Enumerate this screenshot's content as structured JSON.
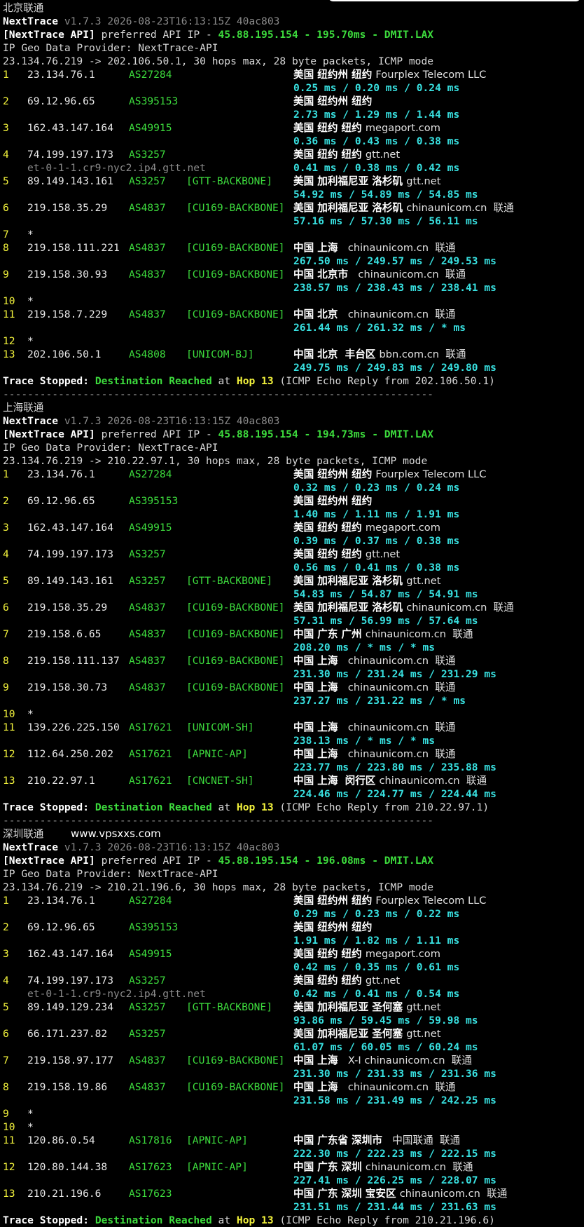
{
  "sections": [
    {
      "title": "北京联通",
      "version": "v1.7.3 2026-08-23T16:13:15Z 40ac803",
      "api_ip": "45.88.195.154",
      "api_ms": "195.70ms",
      "api_node": "DMIT.LAX",
      "geo_provider": "IP Geo Data Provider: NextTrace-API",
      "trace_info": "23.134.76.219 -> 202.106.50.1, 30 hops max, 28 byte packets, ICMP mode",
      "hops": [
        {
          "n": "1",
          "ip": "23.134.76.1",
          "asn": "AS27284",
          "bb": "",
          "geo": "美国 纽约州 纽约",
          "org": "Fourplex Telecom LLC",
          "time": "0.25 ms / 0.20 ms / 0.24 ms",
          "rdns": ""
        },
        {
          "n": "2",
          "ip": "69.12.96.65",
          "asn": "AS395153",
          "bb": "",
          "geo": "美国 纽约州 纽约",
          "org": "",
          "time": "2.73 ms / 1.29 ms / 1.44 ms",
          "rdns": ""
        },
        {
          "n": "3",
          "ip": "162.43.147.164",
          "asn": "AS49915",
          "bb": "",
          "geo": "美国 纽约 纽约",
          "org": "megaport.com",
          "time": "0.36 ms / 0.43 ms / 0.38 ms",
          "rdns": ""
        },
        {
          "n": "4",
          "ip": "74.199.197.173",
          "asn": "AS3257",
          "bb": "",
          "geo": "美国 纽约 纽约",
          "org": "gtt.net",
          "time": "0.41 ms / 0.38 ms / 0.42 ms",
          "rdns": "et-0-1-1.cr9-nyc2.ip4.gtt.net"
        },
        {
          "n": "5",
          "ip": "89.149.143.161",
          "asn": "AS3257",
          "bb": "[GTT-BACKBONE]",
          "geo": "美国 加利福尼亚 洛杉矶",
          "org": "gtt.net",
          "time": "54.92 ms / 54.89 ms / 54.85 ms",
          "rdns": ""
        },
        {
          "n": "6",
          "ip": "219.158.35.29",
          "asn": "AS4837",
          "bb": "[CU169-BACKBONE]",
          "geo": "美国 加利福尼亚 洛杉矶",
          "org": "chinaunicom.cn  联通",
          "time": "57.16 ms / 57.30 ms / 56.11 ms",
          "rdns": ""
        },
        {
          "n": "7",
          "ip": "*",
          "asn": "",
          "bb": "",
          "geo": "",
          "org": "",
          "time": "",
          "rdns": ""
        },
        {
          "n": "8",
          "ip": "219.158.111.221",
          "asn": "AS4837",
          "bb": "[CU169-BACKBONE]",
          "geo": "中国 上海",
          "org": "  chinaunicom.cn  联通",
          "time": "267.50 ms / 249.57 ms / 249.53 ms",
          "rdns": ""
        },
        {
          "n": "9",
          "ip": "219.158.30.93",
          "asn": "AS4837",
          "bb": "[CU169-BACKBONE]",
          "geo": "中国 北京市",
          "org": "  chinaunicom.cn  联通",
          "time": "238.57 ms / 238.43 ms / 238.41 ms",
          "rdns": ""
        },
        {
          "n": "10",
          "ip": "*",
          "asn": "",
          "bb": "",
          "geo": "",
          "org": "",
          "time": "",
          "rdns": ""
        },
        {
          "n": "11",
          "ip": "219.158.7.229",
          "asn": "AS4837",
          "bb": "[CU169-BACKBONE]",
          "geo": "中国 北京",
          "org": "  chinaunicom.cn  联通",
          "time": "261.44 ms / 261.32 ms / * ms",
          "rdns": ""
        },
        {
          "n": "12",
          "ip": "*",
          "asn": "",
          "bb": "",
          "geo": "",
          "org": "",
          "time": "",
          "rdns": ""
        },
        {
          "n": "13",
          "ip": "202.106.50.1",
          "asn": "AS4808",
          "bb": "[UNICOM-BJ]",
          "geo": "中国 北京  丰台区",
          "org": "bbn.com.cn  联通",
          "time": "249.75 ms / 249.83 ms / 249.80 ms",
          "rdns": ""
        }
      ],
      "stop_hop": "Hop 13",
      "stop_from": "(ICMP Echo Reply from 202.106.50.1)"
    },
    {
      "title": "上海联通",
      "version": "v1.7.3 2026-08-23T16:13:15Z 40ac803",
      "api_ip": "45.88.195.154",
      "api_ms": "194.73ms",
      "api_node": "DMIT.LAX",
      "geo_provider": "IP Geo Data Provider: NextTrace-API",
      "trace_info": "23.134.76.219 -> 210.22.97.1, 30 hops max, 28 byte packets, ICMP mode",
      "hops": [
        {
          "n": "1",
          "ip": "23.134.76.1",
          "asn": "AS27284",
          "bb": "",
          "geo": "美国 纽约州 纽约",
          "org": "Fourplex Telecom LLC",
          "time": "0.32 ms / 0.23 ms / 0.24 ms",
          "rdns": ""
        },
        {
          "n": "2",
          "ip": "69.12.96.65",
          "asn": "AS395153",
          "bb": "",
          "geo": "美国 纽约州 纽约",
          "org": "",
          "time": "1.40 ms / 1.11 ms / 1.91 ms",
          "rdns": ""
        },
        {
          "n": "3",
          "ip": "162.43.147.164",
          "asn": "AS49915",
          "bb": "",
          "geo": "美国 纽约 纽约",
          "org": "megaport.com",
          "time": "0.39 ms / 0.37 ms / 0.38 ms",
          "rdns": ""
        },
        {
          "n": "4",
          "ip": "74.199.197.173",
          "asn": "AS3257",
          "bb": "",
          "geo": "美国 纽约 纽约",
          "org": "gtt.net",
          "time": "0.56 ms / 0.41 ms / 0.38 ms",
          "rdns": ""
        },
        {
          "n": "5",
          "ip": "89.149.143.161",
          "asn": "AS3257",
          "bb": "[GTT-BACKBONE]",
          "geo": "美国 加利福尼亚 洛杉矶",
          "org": "gtt.net",
          "time": "54.83 ms / 54.87 ms / 54.91 ms",
          "rdns": ""
        },
        {
          "n": "6",
          "ip": "219.158.35.29",
          "asn": "AS4837",
          "bb": "[CU169-BACKBONE]",
          "geo": "美国 加利福尼亚 洛杉矶",
          "org": "chinaunicom.cn  联通",
          "time": "57.31 ms / 56.99 ms / 57.64 ms",
          "rdns": ""
        },
        {
          "n": "7",
          "ip": "219.158.6.65",
          "asn": "AS4837",
          "bb": "[CU169-BACKBONE]",
          "geo": "中国 广东 广州",
          "org": "chinaunicom.cn  联通",
          "time": "208.20 ms / * ms / * ms",
          "rdns": ""
        },
        {
          "n": "8",
          "ip": "219.158.111.137",
          "asn": "AS4837",
          "bb": "[CU169-BACKBONE]",
          "geo": "中国 上海",
          "org": "  chinaunicom.cn  联通",
          "time": "231.30 ms / 231.24 ms / 231.29 ms",
          "rdns": ""
        },
        {
          "n": "9",
          "ip": "219.158.30.73",
          "asn": "AS4837",
          "bb": "[CU169-BACKBONE]",
          "geo": "中国 上海",
          "org": "  chinaunicom.cn  联通",
          "time": "237.27 ms / 231.22 ms / * ms",
          "rdns": ""
        },
        {
          "n": "10",
          "ip": "*",
          "asn": "",
          "bb": "",
          "geo": "",
          "org": "",
          "time": "",
          "rdns": ""
        },
        {
          "n": "11",
          "ip": "139.226.225.150",
          "asn": "AS17621",
          "bb": "[UNICOM-SH]",
          "geo": "中国 上海",
          "org": "  chinaunicom.cn  联通",
          "time": "238.13 ms / * ms / * ms",
          "rdns": ""
        },
        {
          "n": "12",
          "ip": "112.64.250.202",
          "asn": "AS17621",
          "bb": "[APNIC-AP]",
          "geo": "中国 上海",
          "org": "  chinaunicom.cn  联通",
          "time": "223.77 ms / 223.80 ms / 235.88 ms",
          "rdns": ""
        },
        {
          "n": "13",
          "ip": "210.22.97.1",
          "asn": "AS17621",
          "bb": "[CNCNET-SH]",
          "geo": "中国 上海  闵行区",
          "org": "chinaunicom.cn  联通",
          "time": "224.46 ms / 224.77 ms / 224.44 ms",
          "rdns": ""
        }
      ],
      "stop_hop": "Hop 13",
      "stop_from": "(ICMP Echo Reply from 210.22.97.1)"
    },
    {
      "title": "深圳联通",
      "watermark": "www.vpsxxs.com",
      "version": "v1.7.3 2026-08-23T16:13:15Z 40ac803",
      "api_ip": "45.88.195.154",
      "api_ms": "196.08ms",
      "api_node": "DMIT.LAX",
      "geo_provider": "IP Geo Data Provider: NextTrace-API",
      "trace_info": "23.134.76.219 -> 210.21.196.6, 30 hops max, 28 byte packets, ICMP mode",
      "hops": [
        {
          "n": "1",
          "ip": "23.134.76.1",
          "asn": "AS27284",
          "bb": "",
          "geo": "美国 纽约州 纽约",
          "org": "Fourplex Telecom LLC",
          "time": "0.29 ms / 0.23 ms / 0.22 ms",
          "rdns": ""
        },
        {
          "n": "2",
          "ip": "69.12.96.65",
          "asn": "AS395153",
          "bb": "",
          "geo": "美国 纽约州 纽约",
          "org": "",
          "time": "1.91 ms / 1.82 ms / 1.11 ms",
          "rdns": ""
        },
        {
          "n": "3",
          "ip": "162.43.147.164",
          "asn": "AS49915",
          "bb": "",
          "geo": "美国 纽约 纽约",
          "org": "megaport.com",
          "time": "0.42 ms / 0.35 ms / 0.61 ms",
          "rdns": ""
        },
        {
          "n": "4",
          "ip": "74.199.197.173",
          "asn": "AS3257",
          "bb": "",
          "geo": "美国 纽约 纽约",
          "org": "gtt.net",
          "time": "0.42 ms / 0.41 ms / 0.54 ms",
          "rdns": "et-0-1-1.cr9-nyc2.ip4.gtt.net"
        },
        {
          "n": "5",
          "ip": "89.149.129.234",
          "asn": "AS3257",
          "bb": "[GTT-BACKBONE]",
          "geo": "美国 加利福尼亚 圣何塞",
          "org": "gtt.net",
          "time": "93.86 ms / 59.45 ms / 59.98 ms",
          "rdns": ""
        },
        {
          "n": "6",
          "ip": "66.171.237.82",
          "asn": "AS3257",
          "bb": "",
          "geo": "美国 加利福尼亚 圣何塞",
          "org": "gtt.net",
          "time": "61.07 ms / 60.05 ms / 60.24 ms",
          "rdns": ""
        },
        {
          "n": "7",
          "ip": "219.158.97.177",
          "asn": "AS4837",
          "bb": "[CU169-BACKBONE]",
          "geo": "中国 上海",
          "org": "  X-I chinaunicom.cn  联通",
          "time": "231.30 ms / 231.33 ms / 231.36 ms",
          "rdns": ""
        },
        {
          "n": "8",
          "ip": "219.158.19.86",
          "asn": "AS4837",
          "bb": "[CU169-BACKBONE]",
          "geo": "中国 上海",
          "org": "  chinaunicom.cn  联通",
          "time": "231.58 ms / 231.49 ms / 242.25 ms",
          "rdns": ""
        },
        {
          "n": "9",
          "ip": "*",
          "asn": "",
          "bb": "",
          "geo": "",
          "org": "",
          "time": "",
          "rdns": ""
        },
        {
          "n": "10",
          "ip": "*",
          "asn": "",
          "bb": "",
          "geo": "",
          "org": "",
          "time": "",
          "rdns": ""
        },
        {
          "n": "11",
          "ip": "120.86.0.54",
          "asn": "AS17816",
          "bb": "[APNIC-AP]",
          "geo": "中国 广东省 深圳市",
          "org": "  中国联通  联通",
          "time": "222.30 ms / 222.23 ms / 222.15 ms",
          "rdns": ""
        },
        {
          "n": "12",
          "ip": "120.80.144.38",
          "asn": "AS17623",
          "bb": "[APNIC-AP]",
          "geo": "中国 广东 深圳",
          "org": "chinaunicom.cn  联通",
          "time": "227.41 ms / 226.25 ms / 228.07 ms",
          "rdns": ""
        },
        {
          "n": "13",
          "ip": "210.21.196.6",
          "asn": "AS17623",
          "bb": "",
          "geo": "中国 广东 深圳 宝安区",
          "org": "chinaunicom.cn  联通",
          "time": "231.51 ms / 231.44 ms / 231.63 ms",
          "rdns": ""
        }
      ],
      "stop_hop": "Hop 13",
      "stop_from": "(ICMP Echo Reply from 210.21.196.6)"
    }
  ],
  "labels": {
    "app": "NextTrace",
    "api_prefix": "[NextTrace API]",
    "api_text": " preferred API IP - ",
    "dash": " - ",
    "trace_stopped": "Trace Stopped:",
    "dest_reached": "Destination Reached",
    "at": " at ",
    "separator": "----------------------------------------------------------------------"
  }
}
